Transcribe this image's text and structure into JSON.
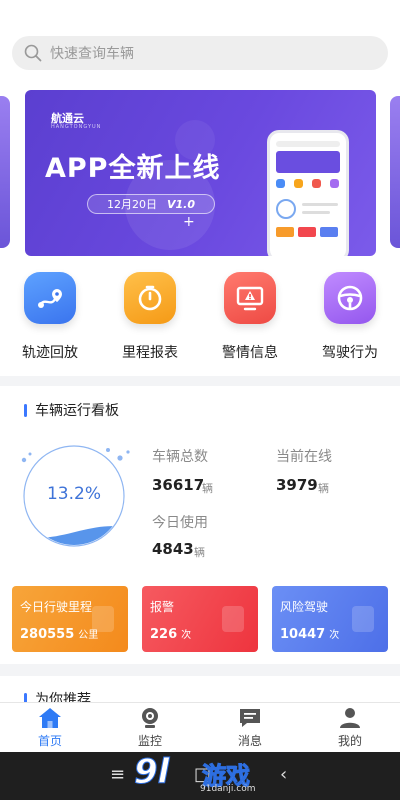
{
  "search": {
    "placeholder": "快速查询车辆"
  },
  "banner": {
    "brand": "航通云",
    "brand_sub": "HANGTONGYUN",
    "headline": "APP全新上线",
    "date": "12月20日",
    "version": "V1.0",
    "plus": "+"
  },
  "quick_actions": [
    {
      "label": "轨迹回放",
      "icon": "route-icon",
      "color": "#4a8cf6"
    },
    {
      "label": "里程报表",
      "icon": "timer-icon",
      "color": "#f7a51c"
    },
    {
      "label": "警情信息",
      "icon": "alert-monitor-icon",
      "color": "#f0584d"
    },
    {
      "label": "驾驶行为",
      "icon": "steering-wheel-icon",
      "color": "#a46cf0"
    }
  ],
  "dashboard": {
    "title": "车辆运行看板",
    "gauge_value": "13.2%",
    "gauge_fraction": 0.132,
    "total_label": "车辆总数",
    "total_value": "36617",
    "total_unit": "辆",
    "online_label": "当前在线",
    "online_value": "3979",
    "online_unit": "辆",
    "today_label": "今日使用",
    "today_value": "4843",
    "today_unit": "辆",
    "cards": [
      {
        "title": "今日行驶里程",
        "value": "280555",
        "unit": "公里",
        "color": "#f79b2b"
      },
      {
        "title": "报警",
        "value": "226",
        "unit": "次",
        "color": "#f2474e"
      },
      {
        "title": "风险驾驶",
        "value": "10447",
        "unit": "次",
        "color": "#5a7ff0"
      }
    ]
  },
  "recommend": {
    "title": "为你推荐"
  },
  "tabbar": [
    {
      "label": "首页",
      "icon": "home-icon",
      "active": true
    },
    {
      "label": "监控",
      "icon": "camera-icon",
      "active": false
    },
    {
      "label": "消息",
      "icon": "message-icon",
      "active": false
    },
    {
      "label": "我的",
      "icon": "user-icon",
      "active": false
    }
  ],
  "system_nav": {
    "menu": "≡",
    "home": "□",
    "back": "‹"
  },
  "watermark": {
    "logo": "9l",
    "text": "游戏",
    "url": "91danji.com"
  },
  "colors": {
    "accent": "#2f7bf5",
    "banner": "#5b3fd0"
  }
}
